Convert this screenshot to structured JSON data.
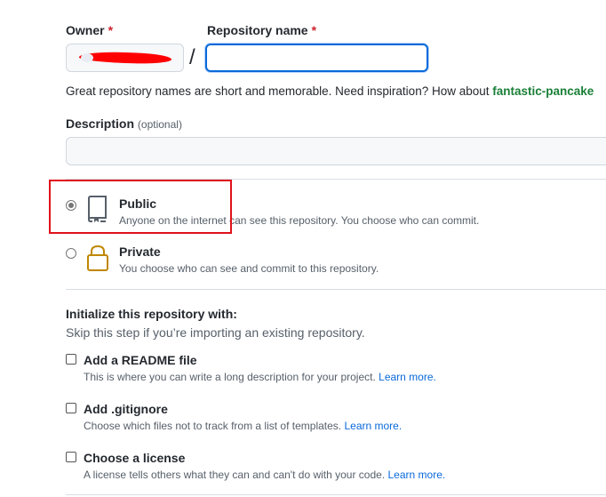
{
  "owner": {
    "label": "Owner",
    "required_mark": "*"
  },
  "repo_name": {
    "label": "Repository name",
    "required_mark": "*",
    "value": ""
  },
  "separator": "/",
  "hint": {
    "text": "Great repository names are short and memorable. Need inspiration? How about ",
    "suggestion": "fantastic-pancake"
  },
  "description": {
    "label": "Description",
    "optional": "(optional)",
    "value": ""
  },
  "visibility": {
    "public": {
      "title": "Public",
      "subtitle": "Anyone on the internet can see this repository. You choose who can commit.",
      "selected": true
    },
    "private": {
      "title": "Private",
      "subtitle": "You choose who can see and commit to this repository.",
      "selected": false
    }
  },
  "init": {
    "title": "Initialize this repository with:",
    "subtitle": "Skip this step if you’re importing an existing repository.",
    "readme": {
      "title": "Add a README file",
      "subtitle": "This is where you can write a long description for your project. ",
      "link": "Learn more."
    },
    "gitignore": {
      "title": "Add .gitignore",
      "subtitle": "Choose which files not to track from a list of templates. ",
      "link": "Learn more."
    },
    "license": {
      "title": "Choose a license",
      "subtitle": "A license tells others what they can and can't do with your code. ",
      "link": "Learn more."
    }
  },
  "colors": {
    "accent": "#0969da",
    "suggestion": "#1a7f37",
    "required": "#cf222e",
    "annotation": "#e0121b"
  },
  "icons": {
    "public": "repo-icon",
    "private": "lock-icon"
  }
}
